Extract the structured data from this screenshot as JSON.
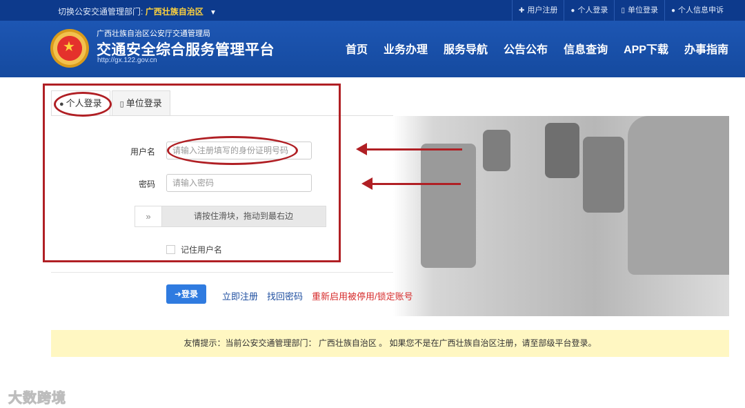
{
  "topbar": {
    "switch_prefix": "切换公安交通管理部门:",
    "switch_region": "广西壮族自治区",
    "links": [
      {
        "icon": "plus-icon",
        "label": "用户注册"
      },
      {
        "icon": "user-icon",
        "label": "个人登录"
      },
      {
        "icon": "building-icon",
        "label": "单位登录"
      },
      {
        "icon": "user-icon",
        "label": "个人信息申诉"
      }
    ]
  },
  "header": {
    "org": "广西壮族自治区公安厅交通管理局",
    "site_name": "交通安全综合服务管理平台",
    "url": "http://gx.122.gov.cn",
    "nav": [
      "首页",
      "业务办理",
      "服务导航",
      "公告公布",
      "信息查询",
      "APP下载",
      "办事指南"
    ]
  },
  "login": {
    "tabs": [
      {
        "icon": "user-icon",
        "label": "个人登录"
      },
      {
        "icon": "building-icon",
        "label": "单位登录"
      }
    ],
    "username_label": "用户名",
    "username_placeholder": "请输入注册填写的身份证明号码",
    "password_label": "密码",
    "password_placeholder": "请输入密码",
    "slider_handle": "»",
    "slider_text": "请按住滑块，拖动到最右边",
    "remember_label": "记住用户名",
    "login_button": "登录",
    "register_link": "立即注册",
    "recover_link": "找回密码",
    "reactivate_link": "重新启用被停用/锁定账号"
  },
  "notice": {
    "text": "友情提示：当前公安交通管理部门： 广西壮族自治区 。 如果您不是在广西壮族自治区注册，请至部级平台登录。"
  },
  "watermark": "大数跨境",
  "colors": {
    "topbar_bg": "#0d3a8c",
    "header_bg": "#1d56b3",
    "accent_yellow": "#ffd23c",
    "login_button": "#2f7be0",
    "annotation_red": "#b01f24",
    "notice_bg": "#fff7c2"
  }
}
